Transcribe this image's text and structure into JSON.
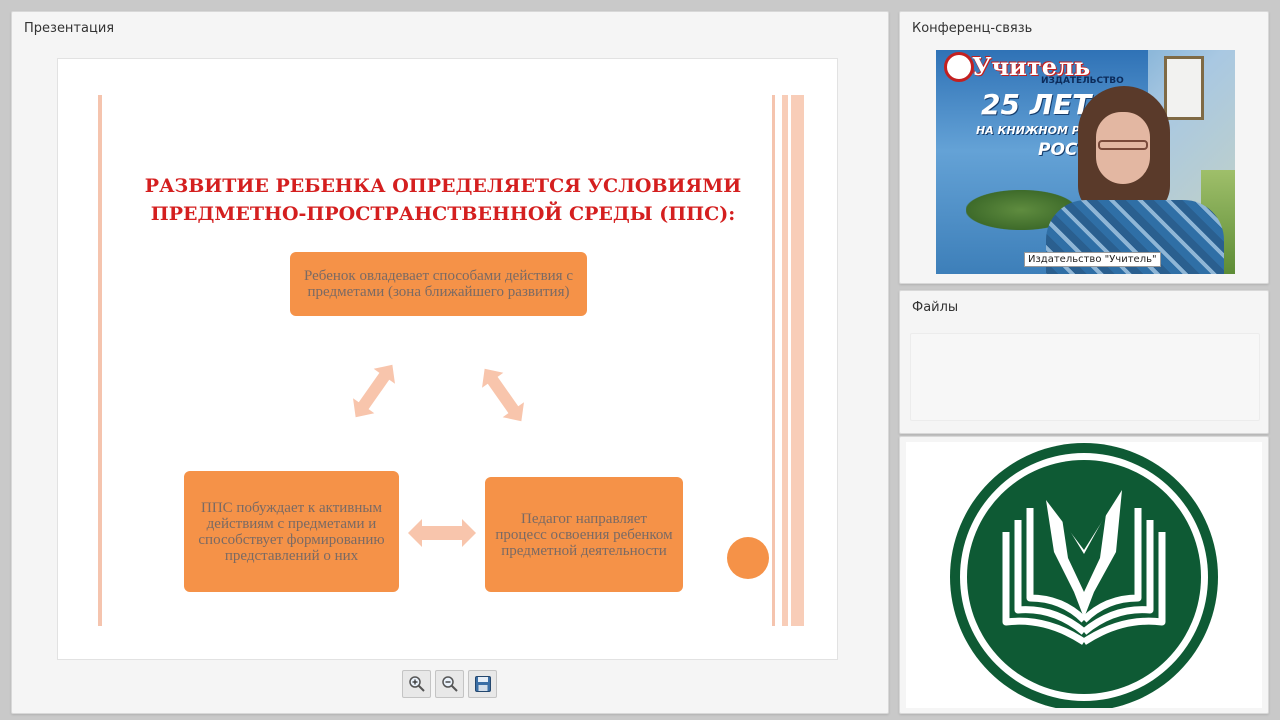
{
  "presentation": {
    "title": "Презентация",
    "slide": {
      "heading_line1": "РАЗВИТИЕ РЕБЕНКА ОПРЕДЕЛЯЕТСЯ УСЛОВИЯМИ",
      "heading_line2": "ПРЕДМЕТНО-ПРОСТРАНСТВЕННОЙ СРЕДЫ (ППС):",
      "box_top": "Ребенок овладевает способами действия с предметами (зона ближайшего развития)",
      "box_bottom_left": "ППС побуждает к активным действиям с предметами и способствует формированию представлений о них",
      "box_bottom_right": "Педагог направляет процесс освоения ребенком предметной деятельности"
    },
    "toolbar": {
      "zoom_in": "zoom-in-icon",
      "zoom_out": "zoom-out-icon",
      "save": "save-icon"
    }
  },
  "conference": {
    "title": "Конференц-связь",
    "poster_brand": "Учитель",
    "poster_sub": "ИЗДАТЕЛЬСТВО",
    "poster_big": "25 ЛЕТ",
    "poster_line2": "НА КНИЖНОМ Р",
    "poster_line3": "РОСС",
    "participant_name": "Издательство \"Учитель\""
  },
  "files": {
    "title": "Файлы"
  },
  "colors": {
    "accent_orange": "#f59248",
    "title_red": "#d41f1f",
    "logo_green": "#0e5a34"
  }
}
